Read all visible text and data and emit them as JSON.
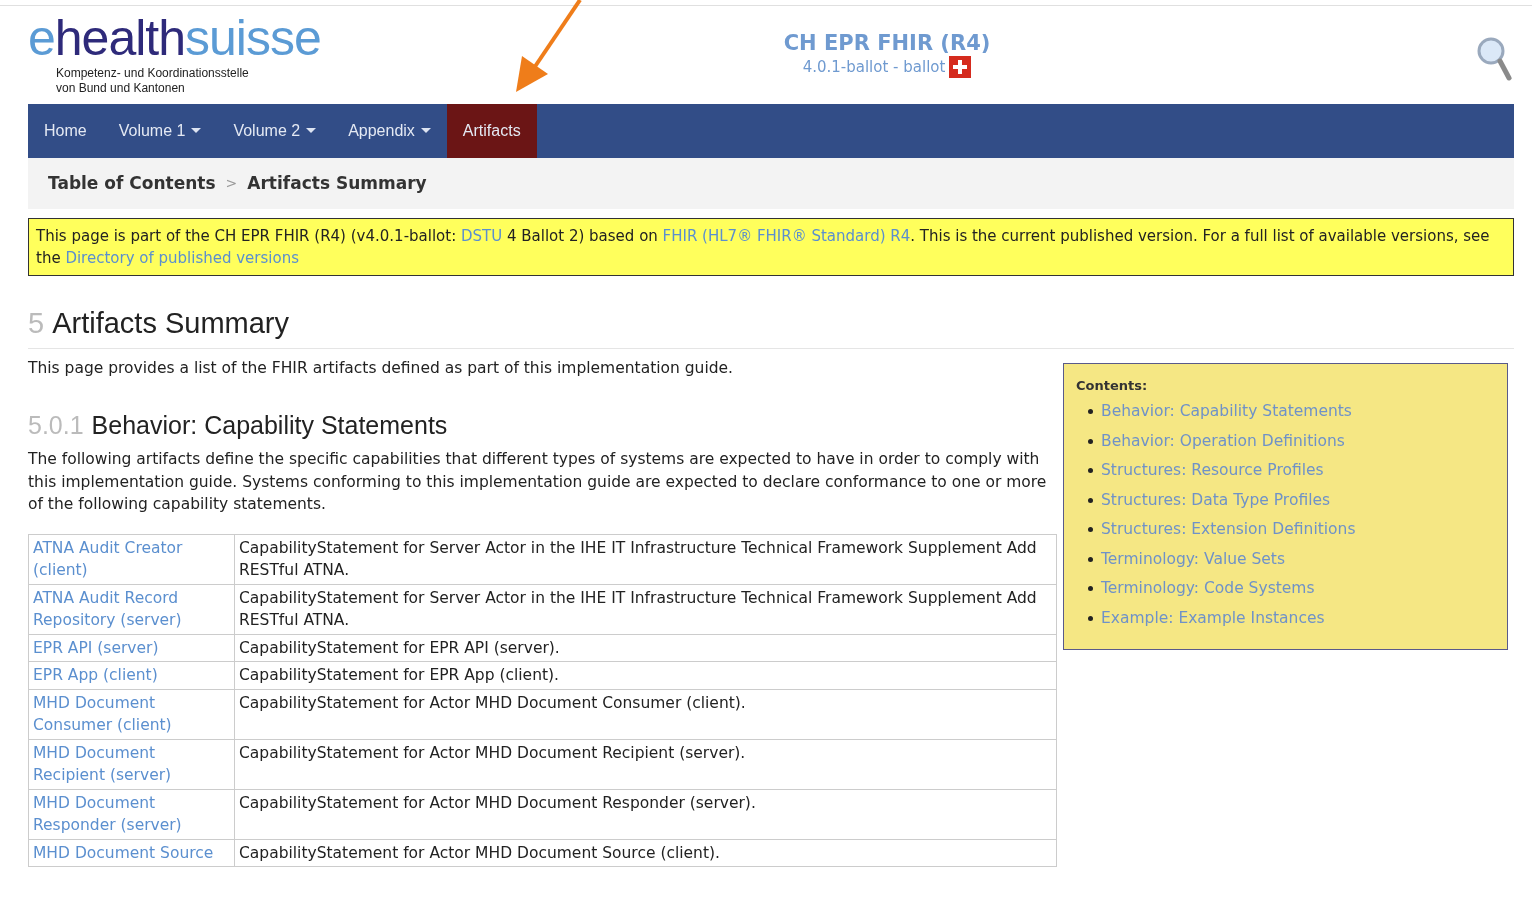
{
  "header": {
    "logo": {
      "part1": "e",
      "part2": "health",
      "part3": "suisse",
      "tagline1": "Kompetenz- und Koordinationsstelle",
      "tagline2": "von Bund und Kantonen"
    },
    "title": "CH EPR FHIR (R4)",
    "subtitle": "4.0.1-ballot - ballot"
  },
  "nav": [
    {
      "label": "Home",
      "selected": false,
      "dropdown": false
    },
    {
      "label": "Volume 1",
      "selected": false,
      "dropdown": true
    },
    {
      "label": "Volume 2",
      "selected": false,
      "dropdown": true
    },
    {
      "label": "Appendix",
      "selected": false,
      "dropdown": true
    },
    {
      "label": "Artifacts",
      "selected": true,
      "dropdown": false
    }
  ],
  "breadcrumb": [
    "Table of Contents",
    "Artifacts Summary"
  ],
  "breadcrumb_separator": ">",
  "notice": [
    {
      "kind": "text",
      "text": "This page is part of the CH EPR FHIR (R4) (v4.0.1-ballot: "
    },
    {
      "kind": "link",
      "text": "DSTU"
    },
    {
      "kind": "text",
      "text": " 4 Ballot 2) based on "
    },
    {
      "kind": "link",
      "text": "FHIR (HL7® FHIR® Standard) R4"
    },
    {
      "kind": "text",
      "text": ". This is the current published version. For a full list of available versions, see the "
    },
    {
      "kind": "link",
      "text": "Directory of published versions"
    }
  ],
  "page_heading": {
    "number": "5",
    "text": "Artifacts Summary"
  },
  "intro": "This page provides a list of the FHIR artifacts defined as part of this implementation guide.",
  "section": {
    "number": "5.0.1",
    "text": "Behavior: Capability Statements",
    "description": "The following artifacts define the specific capabilities that different types of systems are expected to have in order to comply with this implementation guide. Systems conforming to this implementation guide are expected to declare conformance to one or more of the following capability statements."
  },
  "table": {
    "rows": [
      {
        "name": "ATNA Audit Creator (client)",
        "description": "CapabilityStatement for Server Actor in the IHE IT Infrastructure Technical Framework Supplement Add RESTful ATNA."
      },
      {
        "name": "ATNA Audit Record Repository (server)",
        "description": "CapabilityStatement for Server Actor in the IHE IT Infrastructure Technical Framework Supplement Add RESTful ATNA."
      },
      {
        "name": "EPR API (server)",
        "description": "CapabilityStatement for EPR API (server)."
      },
      {
        "name": "EPR App (client)",
        "description": "CapabilityStatement for EPR App (client)."
      },
      {
        "name": "MHD Document Consumer (client)",
        "description": "CapabilityStatement for Actor MHD Document Consumer (client)."
      },
      {
        "name": "MHD Document Recipient (server)",
        "description": "CapabilityStatement for Actor MHD Document Recipient (server)."
      },
      {
        "name": "MHD Document Responder (server)",
        "description": "CapabilityStatement for Actor MHD Document Responder (server)."
      },
      {
        "name": "MHD Document Source",
        "description": "CapabilityStatement for Actor MHD Document Source (client)."
      }
    ]
  },
  "contents": {
    "title": "Contents:",
    "items": [
      "Behavior: Capability Statements",
      "Behavior: Operation Definitions",
      "Structures: Resource Profiles",
      "Structures: Data Type Profiles",
      "Structures: Extension Definitions",
      "Terminology: Value Sets",
      "Terminology: Code Systems",
      "Example: Example Instances"
    ]
  }
}
